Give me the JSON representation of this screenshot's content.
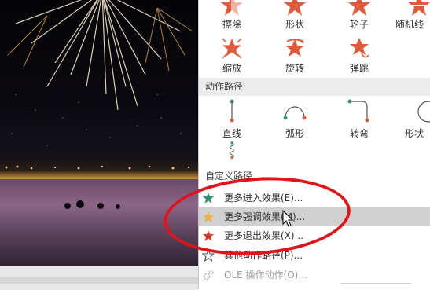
{
  "effects_row1": [
    {
      "label": "擦除",
      "icon": "wipe-icon"
    },
    {
      "label": "形状",
      "icon": "shape-icon"
    },
    {
      "label": "轮子",
      "icon": "wheel-icon"
    },
    {
      "label": "随机线",
      "icon": "random-bars-icon"
    }
  ],
  "effects_row2": [
    {
      "label": "缩放",
      "icon": "zoom-icon"
    },
    {
      "label": "旋转",
      "icon": "swivel-icon"
    },
    {
      "label": "弹跳",
      "icon": "bounce-icon"
    }
  ],
  "motion_paths_header": "动作路径",
  "motion_paths": [
    {
      "label": "直线",
      "icon": "line-path-icon"
    },
    {
      "label": "弧形",
      "icon": "arc-path-icon"
    },
    {
      "label": "转弯",
      "icon": "turn-path-icon"
    },
    {
      "label": "形状",
      "icon": "shape-path-icon"
    }
  ],
  "custom_path_label": "自定义路径",
  "menu": [
    {
      "label": "更多进入效果(E)...",
      "icon": "entrance-star-icon",
      "color": "#3a8a6e"
    },
    {
      "label": "更多强调效果(M)...",
      "icon": "emphasis-star-icon",
      "color": "#f0b03a",
      "highlighted": true
    },
    {
      "label": "更多退出效果(X)...",
      "icon": "exit-star-icon",
      "color": "#d33b2c"
    },
    {
      "label": "其他动作路径(P)...",
      "icon": "motion-path-star-icon",
      "color": "#555555"
    },
    {
      "label": "OLE 操作动作(O)...",
      "icon": "ole-action-icon",
      "color": "#a0a0a0",
      "disabled": true
    }
  ],
  "colors": {
    "effect_accent": "#e05a3c",
    "path_line": "#555555",
    "path_start": "#3a9a6e",
    "path_end": "#e05a3c",
    "annotation_ellipse": "#e0141a"
  }
}
